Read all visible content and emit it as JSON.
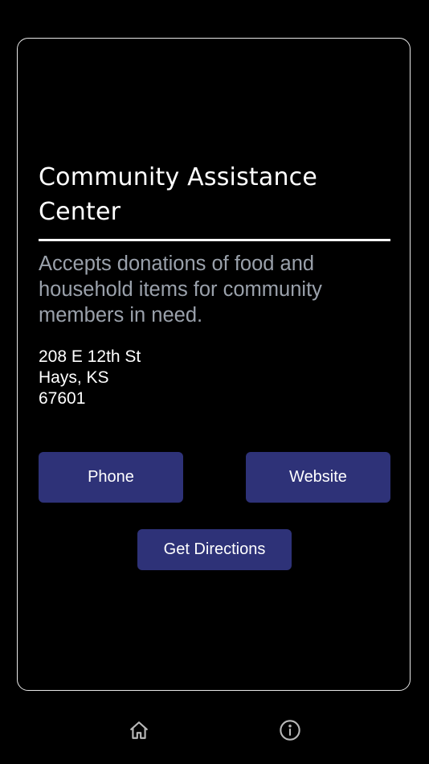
{
  "card": {
    "title": "Community Assistance Center",
    "description": "Accepts donations of food and household items for community members in need.",
    "address": {
      "street": "208 E 12th St",
      "city_state": "Hays, KS",
      "zip": "67601"
    },
    "buttons": {
      "phone": "Phone",
      "website": "Website",
      "directions": "Get Directions"
    }
  },
  "bottom_nav": {
    "items": [
      {
        "icon": "home-icon"
      },
      {
        "icon": "info-icon"
      }
    ]
  },
  "colors": {
    "background": "#000000",
    "button": "#2e3278",
    "description_text": "#9aa1ab",
    "border": "#e8e8e8"
  }
}
